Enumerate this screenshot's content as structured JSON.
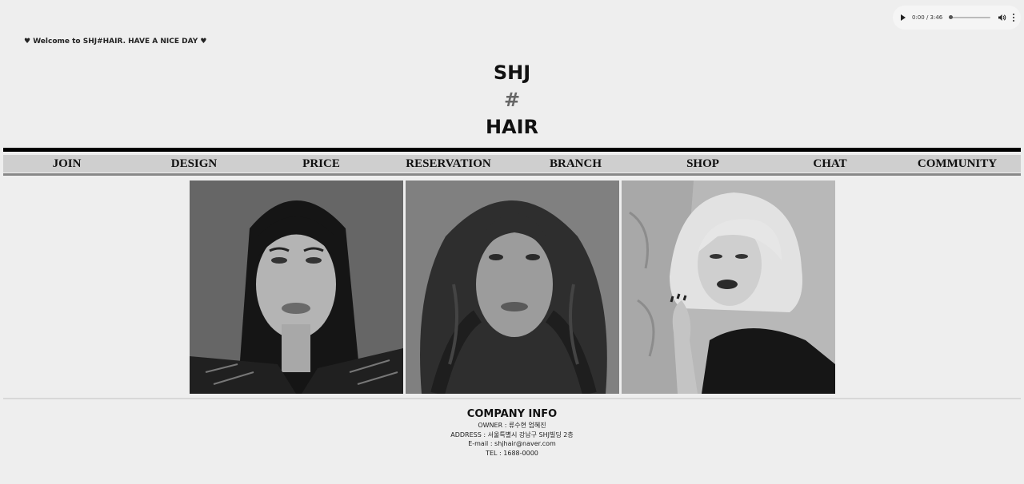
{
  "audio": {
    "time": "0:00 / 3:46",
    "progress": 0
  },
  "welcome": "♥ Welcome to SHJ#HAIR. HAVE A NICE DAY ♥",
  "logo": {
    "line1": "SHJ",
    "line2": "#",
    "line3": "HAIR"
  },
  "nav": [
    "JOIN",
    "DESIGN",
    "PRICE",
    "RESERVATION",
    "BRANCH",
    "SHOP",
    "CHAT",
    "COMMUNITY"
  ],
  "footer": {
    "title": "COMPANY INFO",
    "owner": "OWNER : 류수현 엄혜진",
    "address": "ADDRESS : 서울특별시 강남구 SHJ빌딩 2층",
    "email": "E-mail : shjhair@naver.com",
    "tel": "TEL : 1688-0000"
  }
}
